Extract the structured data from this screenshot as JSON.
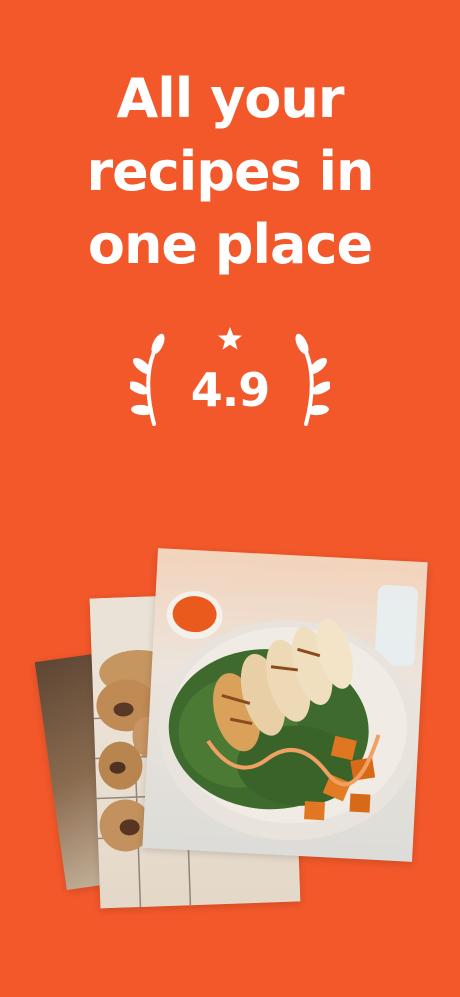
{
  "headline": {
    "line1": "All your",
    "line2": "recipes in",
    "line3": "one place"
  },
  "rating": {
    "value": "4.9",
    "icon": "star-icon",
    "decoration": "laurel-wreath-icon"
  },
  "colors": {
    "background": "#f2582a",
    "text": "#ffffff"
  }
}
